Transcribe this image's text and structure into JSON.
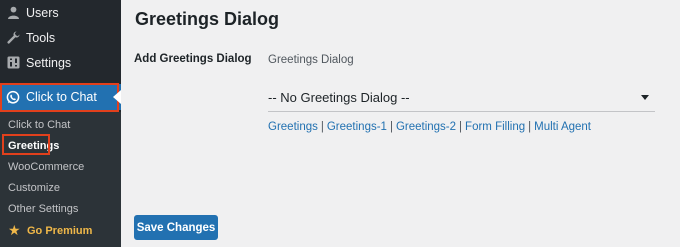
{
  "sidebar": {
    "menu": [
      {
        "label": "Users",
        "icon": "user-icon"
      },
      {
        "label": "Tools",
        "icon": "wrench-icon"
      },
      {
        "label": "Settings",
        "icon": "settings-icon"
      }
    ],
    "click_to_chat": {
      "label": "Click to Chat",
      "icon": "whatsapp-icon"
    },
    "submenu": [
      {
        "label": "Click to Chat"
      },
      {
        "label": "Greetings"
      },
      {
        "label": "WooCommerce"
      },
      {
        "label": "Customize"
      },
      {
        "label": "Other Settings"
      }
    ],
    "go_premium": {
      "label": "Go Premium",
      "icon": "star-icon"
    }
  },
  "main": {
    "title": "Greetings Dialog",
    "field_label": "Add Greetings Dialog",
    "field_caption": "Greetings Dialog",
    "select_value": "-- No Greetings Dialog --",
    "links": [
      "Greetings",
      "Greetings-1",
      "Greetings-2",
      "Form Filling",
      "Multi Agent"
    ],
    "link_separator": "|",
    "save_label": "Save Changes"
  },
  "colors": {
    "sidebar_bg": "#23282d",
    "submenu_bg": "#2c3338",
    "accent": "#2271b1",
    "highlight_outline": "#e2401c",
    "premium": "#f0b849"
  }
}
